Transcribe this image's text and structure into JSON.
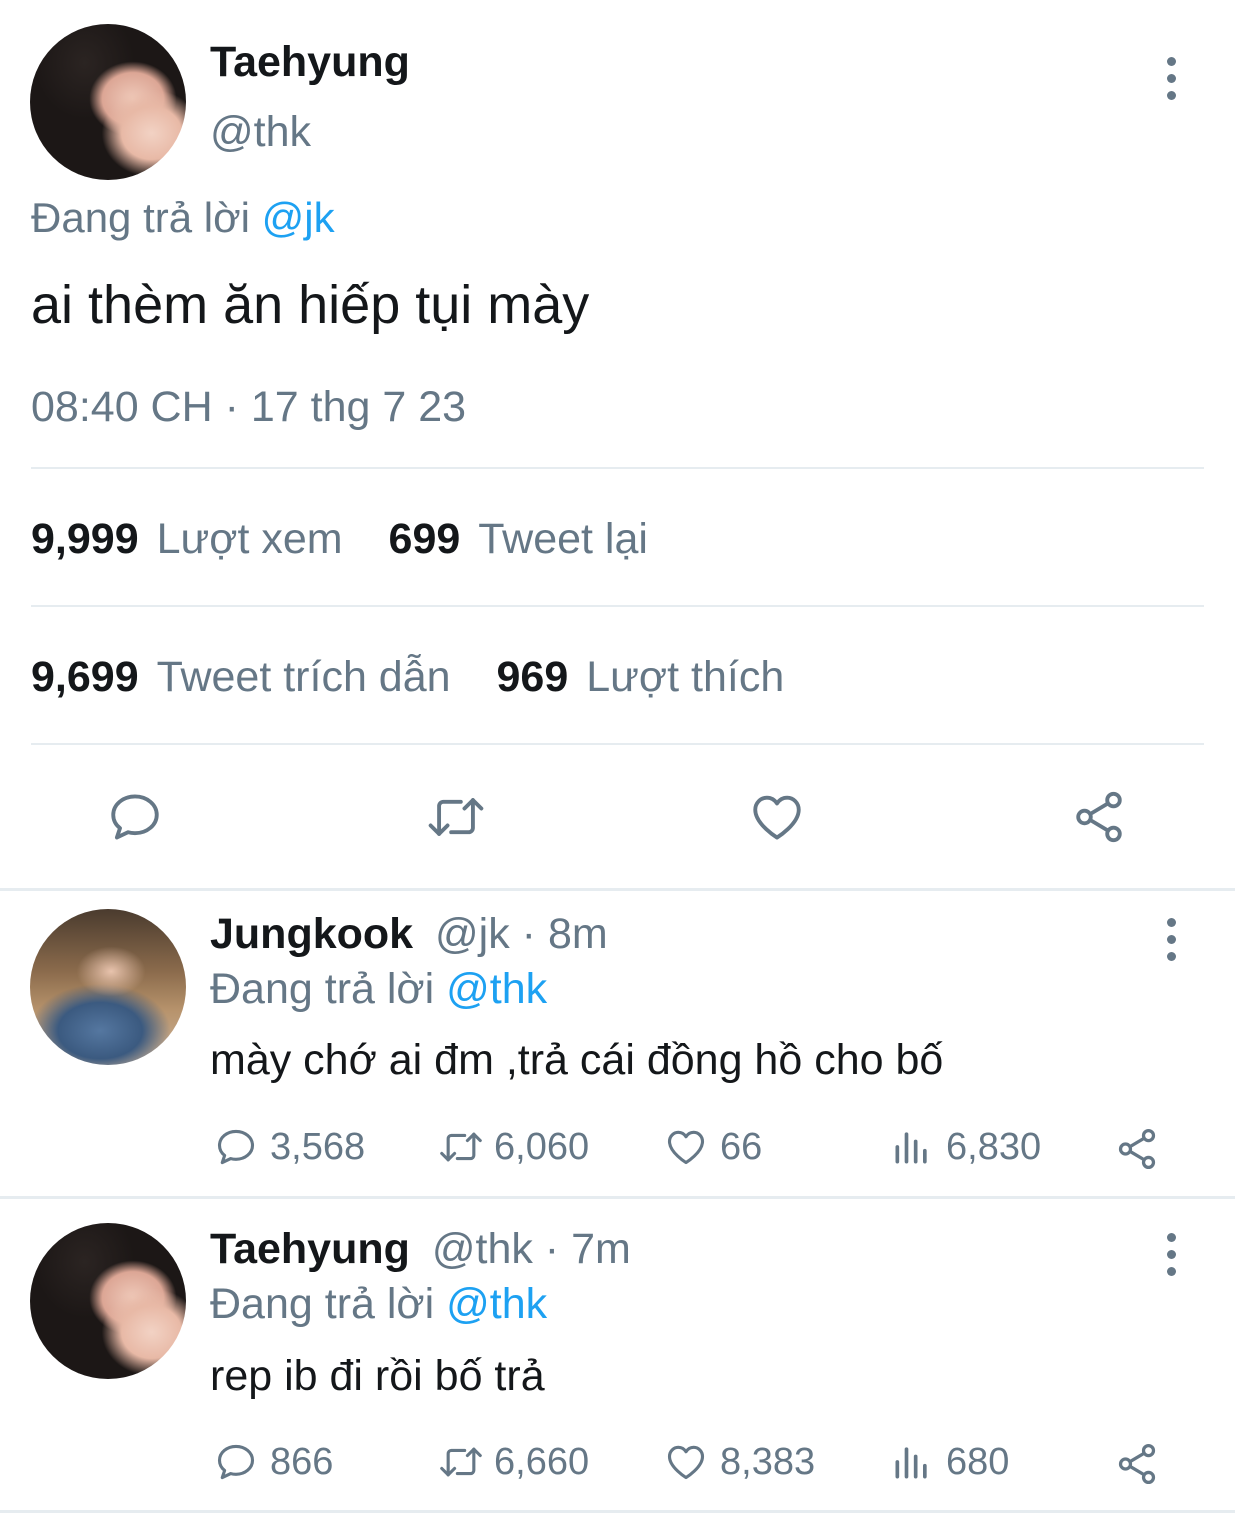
{
  "main_tweet": {
    "name": "Taehyung",
    "handle": "@thk",
    "reply_prefix": "Đang trả lời",
    "reply_to": "@jk",
    "text": "ai thèm ăn hiếp tụi mày",
    "timestamp": "08:40 CH · 17 thg 7 23",
    "stats": {
      "views_count": "9,999",
      "views_label": "Lượt xem",
      "retweets_count": "699",
      "retweets_label": "Tweet lại",
      "quotes_count": "9,699",
      "quotes_label": "Tweet trích dẫn",
      "likes_count": "969",
      "likes_label": "Lượt thích"
    },
    "actions": [
      "reply-icon",
      "retweet-icon",
      "like-icon",
      "share-icon"
    ]
  },
  "replies": [
    {
      "name": "Jungkook",
      "handle_time": "@jk · 8m",
      "reply_prefix": "Đang trả lời",
      "reply_to": "@thk",
      "text": "mày chớ ai đm ,trả cái đồng hồ cho bố",
      "replies": "3,568",
      "retweets": "6,060",
      "likes": "66",
      "views": "6,830"
    },
    {
      "name": "Taehyung",
      "handle_time": "@thk · 7m",
      "reply_prefix": "Đang trả lời",
      "reply_to": "@thk",
      "text": "rep ib đi rồi bố trả",
      "replies": "866",
      "retweets": "6,660",
      "likes": "8,383",
      "views": "680"
    }
  ],
  "colors": {
    "accent": "#1da1f2",
    "secondary_text": "#657786",
    "divider": "#e6ecf0"
  }
}
